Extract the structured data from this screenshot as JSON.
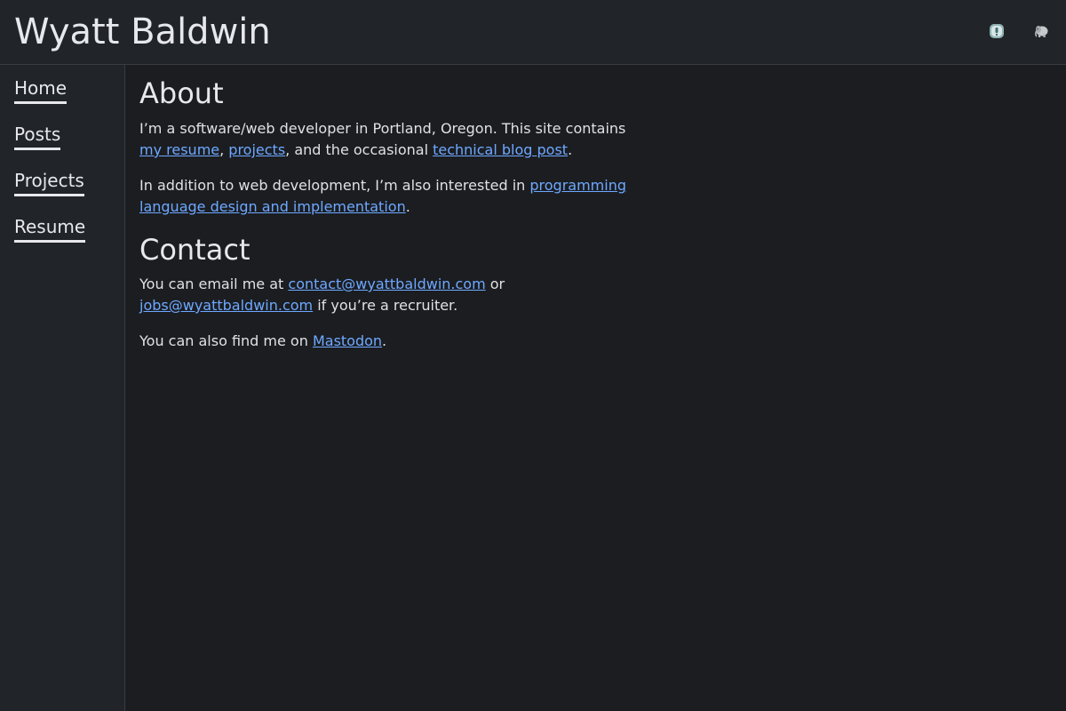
{
  "header": {
    "site_title": "Wyatt Baldwin",
    "icons": [
      "feed-icon",
      "mastodon-icon"
    ]
  },
  "sidebar": {
    "items": [
      {
        "label": "Home"
      },
      {
        "label": "Posts"
      },
      {
        "label": "Projects"
      },
      {
        "label": "Resume"
      }
    ]
  },
  "about": {
    "heading": "About",
    "p1": {
      "t1": "I’m a software/web developer in Portland, Oregon. This site contains ",
      "link_resume": "my resume",
      "t2": ", ",
      "link_projects": "projects",
      "t3": ", and the occasional ",
      "link_blog": "technical blog post",
      "t4": "."
    },
    "p2": {
      "t1": "In addition to web development, I’m also interested in ",
      "link_pl": "programming language design and implementation",
      "t2": "."
    }
  },
  "contact": {
    "heading": "Contact",
    "p1": {
      "t1": "You can email me at ",
      "link_contact": "contact@wyattbaldwin.com",
      "t2": " or ",
      "link_jobs": "jobs@wyattbaldwin.com",
      "t3": " if you’re a recruiter."
    },
    "p2": {
      "t1": "You can also find me on ",
      "link_mastodon": "Mastodon",
      "t2": "."
    }
  },
  "colors": {
    "background": "#1b1d21",
    "panel": "#212428",
    "text": "#e2e4e8",
    "link": "#6ea8ff",
    "border": "#3a3d42"
  }
}
